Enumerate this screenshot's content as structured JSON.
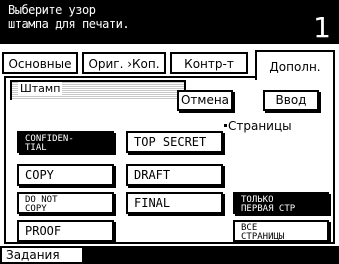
{
  "header": {
    "message_line1": "Выберите узор",
    "message_line2": "штампа для печати.",
    "count": "1"
  },
  "tabs": [
    {
      "label": "Основные"
    },
    {
      "label": "Ориг. ›Коп."
    },
    {
      "label": "Контр-т"
    },
    {
      "label": "Дополн."
    }
  ],
  "stamp_panel": {
    "title": "Штамп",
    "cancel_label": "Отмена",
    "enter_label": "Ввод"
  },
  "stamps": {
    "confidential_line1": "CONFIDEN-",
    "confidential_line2": "TIAL",
    "copy": "COPY",
    "do_not_copy_line1": "DO NOT",
    "do_not_copy_line2": "COPY",
    "proof": "PROOF",
    "top_secret": "TOP SECRET",
    "draft": "DRAFT",
    "final": "FINAL"
  },
  "pages": {
    "label": "Страницы",
    "first_only_line1": "ТОЛЬКО",
    "first_only_line2": "ПЕРВАЯ СТР",
    "all_pages_line1": "ВСЕ",
    "all_pages_line2": "СТРАНИЦЫ"
  },
  "footer": {
    "jobs_label": "Задания"
  }
}
